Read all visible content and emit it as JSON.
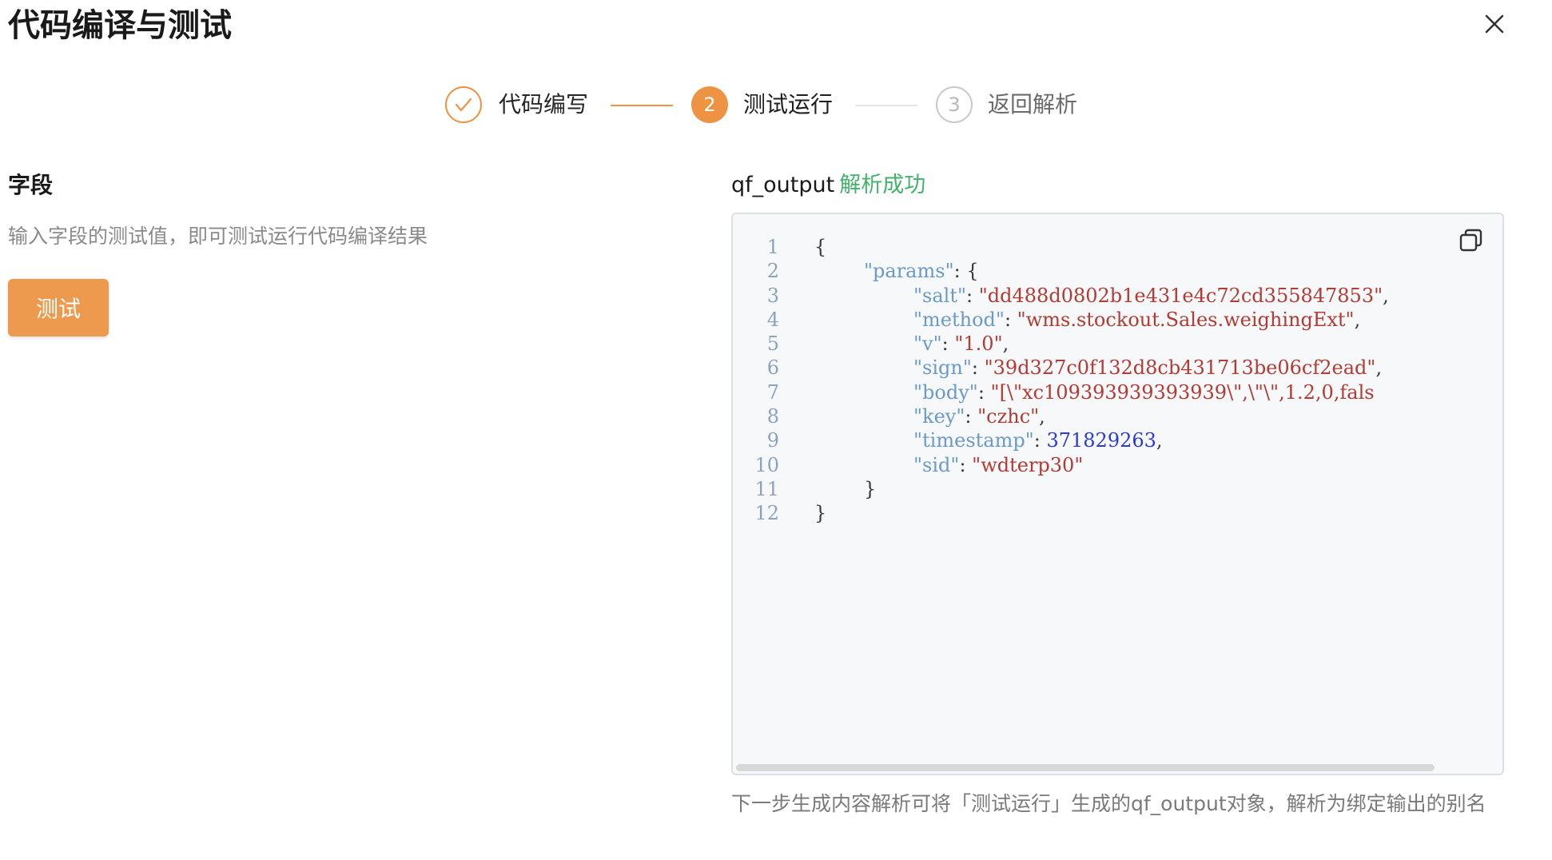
{
  "dialog": {
    "title": "代码编译与测试",
    "close_icon": "close-icon"
  },
  "steps": [
    {
      "label": "代码编写",
      "state": "done",
      "marker": "✓",
      "icon": "check-icon"
    },
    {
      "label": "测试运行",
      "state": "active",
      "marker": "2"
    },
    {
      "label": "返回解析",
      "state": "wait",
      "marker": "3"
    }
  ],
  "left": {
    "field_title": "字段",
    "field_desc": "输入字段的测试值，即可测试运行代码编译结果",
    "test_button": "测试"
  },
  "output": {
    "name": "qf_output",
    "status": "解析成功",
    "copy_icon": "copy-icon",
    "lines": [
      {
        "n": "1",
        "indent": 0,
        "tokens": [
          {
            "t": "punc",
            "v": "{"
          }
        ]
      },
      {
        "n": "2",
        "indent": 1,
        "tokens": [
          {
            "t": "key",
            "v": "\"params\""
          },
          {
            "t": "punc",
            "v": ": {"
          }
        ]
      },
      {
        "n": "3",
        "indent": 2,
        "tokens": [
          {
            "t": "key",
            "v": "\"salt\""
          },
          {
            "t": "punc",
            "v": ": "
          },
          {
            "t": "str",
            "v": "\"dd488d0802b1e431e4c72cd355847853\""
          },
          {
            "t": "punc",
            "v": ","
          }
        ]
      },
      {
        "n": "4",
        "indent": 2,
        "tokens": [
          {
            "t": "key",
            "v": "\"method\""
          },
          {
            "t": "punc",
            "v": ": "
          },
          {
            "t": "str",
            "v": "\"wms.stockout.Sales.weighingExt\""
          },
          {
            "t": "punc",
            "v": ","
          }
        ]
      },
      {
        "n": "5",
        "indent": 2,
        "tokens": [
          {
            "t": "key",
            "v": "\"v\""
          },
          {
            "t": "punc",
            "v": ": "
          },
          {
            "t": "str",
            "v": "\"1.0\""
          },
          {
            "t": "punc",
            "v": ","
          }
        ]
      },
      {
        "n": "6",
        "indent": 2,
        "tokens": [
          {
            "t": "key",
            "v": "\"sign\""
          },
          {
            "t": "punc",
            "v": ": "
          },
          {
            "t": "str",
            "v": "\"39d327c0f132d8cb431713be06cf2ead\""
          },
          {
            "t": "punc",
            "v": ","
          }
        ]
      },
      {
        "n": "7",
        "indent": 2,
        "tokens": [
          {
            "t": "key",
            "v": "\"body\""
          },
          {
            "t": "punc",
            "v": ": "
          },
          {
            "t": "str",
            "v": "\"[\\\"xc109393939393939\\\",\\\"\\\",1.2,0,fals"
          }
        ]
      },
      {
        "n": "8",
        "indent": 2,
        "tokens": [
          {
            "t": "key",
            "v": "\"key\""
          },
          {
            "t": "punc",
            "v": ": "
          },
          {
            "t": "str",
            "v": "\"czhc\""
          },
          {
            "t": "punc",
            "v": ","
          }
        ]
      },
      {
        "n": "9",
        "indent": 2,
        "tokens": [
          {
            "t": "key",
            "v": "\"timestamp\""
          },
          {
            "t": "punc",
            "v": ": "
          },
          {
            "t": "num",
            "v": "371829263"
          },
          {
            "t": "punc",
            "v": ","
          }
        ]
      },
      {
        "n": "10",
        "indent": 2,
        "tokens": [
          {
            "t": "key",
            "v": "\"sid\""
          },
          {
            "t": "punc",
            "v": ": "
          },
          {
            "t": "str",
            "v": "\"wdterp30\""
          }
        ]
      },
      {
        "n": "11",
        "indent": 1,
        "tokens": [
          {
            "t": "punc",
            "v": "}"
          }
        ]
      },
      {
        "n": "12",
        "indent": 0,
        "tokens": [
          {
            "t": "punc",
            "v": "}"
          }
        ]
      }
    ],
    "footer_note": "下一步生成内容解析可将「测试运行」生成的qf_output对象，解析为绑定输出的别名"
  },
  "colors": {
    "accent": "#ee9343",
    "success": "#43b36b",
    "json_key": "#6a9ac8",
    "json_string": "#b33b34",
    "json_number": "#2b3cd6"
  }
}
